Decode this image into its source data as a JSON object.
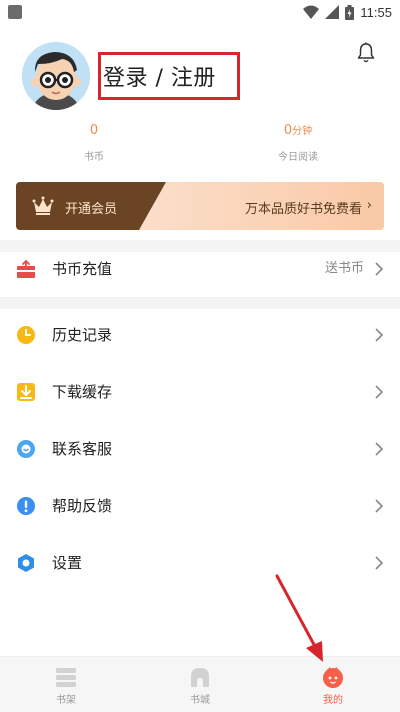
{
  "status_bar": {
    "time": "11:55"
  },
  "header": {
    "login_label": "登录 / 注册"
  },
  "stats": {
    "coins": {
      "value": "0",
      "label": "书币"
    },
    "reading": {
      "value": "0",
      "unit": "分钟",
      "label": "今日阅读"
    }
  },
  "vip": {
    "label": "开通会员",
    "promo": "万本品质好书免费看",
    "chevron": "›"
  },
  "menu": {
    "recharge": {
      "label": "书币充值",
      "sub": "送书币",
      "icon": "gift-icon"
    },
    "items": [
      {
        "label": "历史记录",
        "icon": "clock-icon"
      },
      {
        "label": "下载缓存",
        "icon": "download-icon"
      },
      {
        "label": "联系客服",
        "icon": "smile-icon"
      },
      {
        "label": "帮助反馈",
        "icon": "info-icon"
      },
      {
        "label": "设置",
        "icon": "settings-icon"
      }
    ]
  },
  "bottom_nav": {
    "items": [
      {
        "label": "书架",
        "icon": "bookshelf-icon"
      },
      {
        "label": "书城",
        "icon": "bookstore-icon"
      },
      {
        "label": "我的",
        "icon": "profile-icon",
        "active": true
      }
    ]
  },
  "colors": {
    "accent": "#f4604a",
    "stat_value": "#f08a4b",
    "vip_dark": "#6b4423",
    "annotation_red": "#d6262c"
  }
}
